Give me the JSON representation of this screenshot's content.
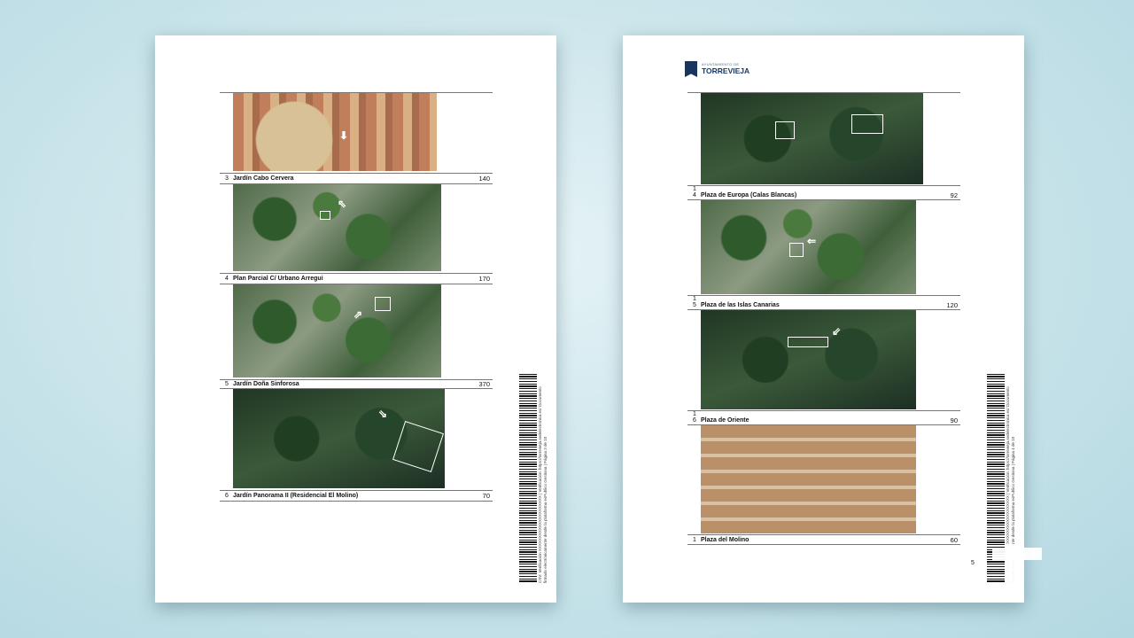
{
  "left_page": {
    "rows": [
      {
        "num": "3",
        "label": "Jardín Cabo Cervera",
        "value": "140"
      },
      {
        "num": "4",
        "label": "Plan Parcial C/ Urbano Arregui",
        "value": "170"
      },
      {
        "num": "5",
        "label": "Jardín Doña Sinforosa",
        "value": "370"
      },
      {
        "num": "6",
        "label": "Jardín Panorama II (Residencial El Molino)",
        "value": "70"
      }
    ],
    "side_text": "CSV: Verificación XXXXXXXXXXXXXXXXXXXXX | Verificación: https://torrevieja.sedelectronica.es/ Documento firmado electrónicamente desde la plataforma esPublico Gestiona | Página 3 de 10"
  },
  "right_page": {
    "logo": {
      "small": "AYUNTAMIENTO DE",
      "big": "TORREVIEJA"
    },
    "rows": [
      {
        "num": "1",
        "num2": "4",
        "label": "Plaza de Europa (Calas Blancas)",
        "value": "92"
      },
      {
        "num": "1",
        "num2": "5",
        "label": "Plaza de las Islas Canarias",
        "value": "120"
      },
      {
        "num": "1",
        "num2": "6",
        "label": "Plaza de Oriente",
        "value": "90"
      },
      {
        "num": "1",
        "label": "Plaza del Molino",
        "value": "60"
      }
    ],
    "side_text": "CSV: Verificación XXXXXXXXXXXXXXXXXXXXX | Verificación: https://torrevieja.sedelectronica.es/ Documento firmado electrónicamente desde la plataforma esPublico Gestiona | Página 4 de 10",
    "page_number": "5"
  },
  "colors": {
    "accent": "#16365e",
    "background": "#cde6ec"
  },
  "icons": [
    "torrevieja-logo-icon",
    "barcode-icon",
    "corner-mark-icon"
  ]
}
